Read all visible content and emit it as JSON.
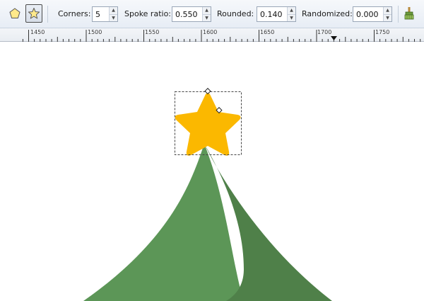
{
  "toolbar": {
    "tool_polygon_icon": "pentagon-icon",
    "tool_star_icon": "star-icon",
    "corners_label": "Corners:",
    "corners_value": "5",
    "spoke_label": "Spoke ratio:",
    "spoke_value": "0.550",
    "rounded_label": "Rounded:",
    "rounded_value": "0.140",
    "randomized_label": "Randomized:",
    "randomized_value": "0.000",
    "reset_icon": "broom-icon"
  },
  "ruler": {
    "labels": [
      "1450",
      "1500",
      "1550",
      "1600",
      "1650",
      "1700",
      "1750"
    ]
  },
  "colors": {
    "star_fill": "#fbb800",
    "tree_light": "#5c9657",
    "tree_dark": "#4f8049",
    "toolbar_bg": "#eef2f7"
  }
}
